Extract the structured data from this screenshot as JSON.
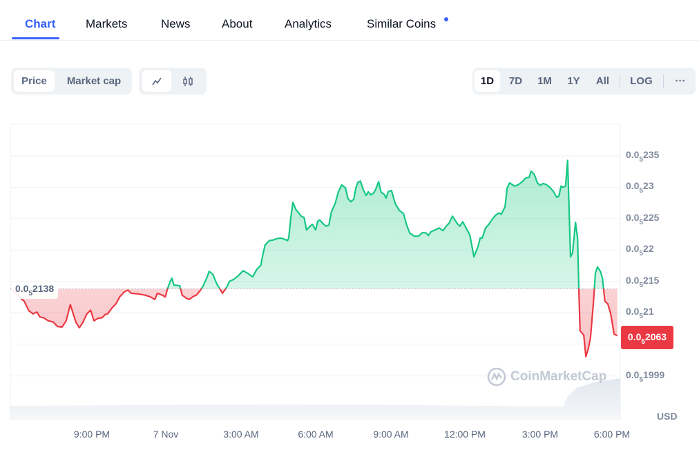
{
  "tabs": [
    {
      "label": "Chart",
      "active": true
    },
    {
      "label": "Markets"
    },
    {
      "label": "News"
    },
    {
      "label": "About"
    },
    {
      "label": "Analytics"
    },
    {
      "label": "Similar Coins",
      "has_dot": true
    }
  ],
  "toolbar": {
    "metric": [
      {
        "label": "Price",
        "active": true
      },
      {
        "label": "Market cap"
      }
    ],
    "chart_style": [
      {
        "icon": "line-chart-icon",
        "active": true
      },
      {
        "icon": "candlestick-icon"
      }
    ],
    "ranges": [
      {
        "label": "1D",
        "active": true
      },
      {
        "label": "7D"
      },
      {
        "label": "1M"
      },
      {
        "label": "1Y"
      },
      {
        "label": "All"
      }
    ],
    "log_label": "LOG",
    "more_label": "···"
  },
  "colors": {
    "accent": "#3861fb",
    "up": "#16c784",
    "down": "#ea3943"
  },
  "watermark": "CoinMarketCap",
  "chart_data": {
    "type": "area",
    "currency_label": "USD",
    "y_tick_labels": [
      {
        "prefix": "0.0",
        "sub": "5",
        "digits": "235",
        "value": 2.35e-06
      },
      {
        "prefix": "0.0",
        "sub": "5",
        "digits": "23",
        "value": 2.3e-06
      },
      {
        "prefix": "0.0",
        "sub": "5",
        "digits": "225",
        "value": 2.25e-06
      },
      {
        "prefix": "0.0",
        "sub": "5",
        "digits": "22",
        "value": 2.2e-06
      },
      {
        "prefix": "0.0",
        "sub": "5",
        "digits": "215",
        "value": 2.15e-06
      },
      {
        "prefix": "0.0",
        "sub": "5",
        "digits": "21",
        "value": 2.1e-06
      },
      {
        "prefix": "0.0",
        "sub": "5",
        "digits": "1999",
        "value": 1.999e-06
      }
    ],
    "x_tick_labels": [
      "9:00 PM",
      "7 Nov",
      "3:00 AM",
      "6:00 AM",
      "9:00 AM",
      "12:00 PM",
      "3:00 PM",
      "6:00 PM"
    ],
    "baseline": {
      "prefix": "0.0",
      "sub": "5",
      "digits": "2138",
      "value": 2.138e-06
    },
    "current": {
      "prefix": "0.0",
      "sub": "5",
      "digits": "2063",
      "value": 2.063e-06
    },
    "grid": true,
    "points": [
      [
        "17:50",
        2.139e-06
      ],
      [
        "18:05",
        2.128e-06
      ],
      [
        "18:22",
        2.118e-06
      ],
      [
        "18:33",
        2.103e-06
      ],
      [
        "18:43",
        2.098e-06
      ],
      [
        "18:52",
        2.101e-06
      ],
      [
        "19:00",
        2.093e-06
      ],
      [
        "19:08",
        2.092e-06
      ],
      [
        "19:20",
        2.087e-06
      ],
      [
        "19:32",
        2.085e-06
      ],
      [
        "19:42",
        2.078e-06
      ],
      [
        "19:53",
        2.077e-06
      ],
      [
        "20:03",
        2.087e-06
      ],
      [
        "20:13",
        2.113e-06
      ],
      [
        "20:20",
        2.098e-06
      ],
      [
        "20:27",
        2.084e-06
      ],
      [
        "20:35",
        2.076e-06
      ],
      [
        "20:43",
        2.084e-06
      ],
      [
        "20:53",
        2.098e-06
      ],
      [
        "21:02",
        2.104e-06
      ],
      [
        "21:10",
        2.087e-06
      ],
      [
        "21:20",
        2.091e-06
      ],
      [
        "21:30",
        2.092e-06
      ],
      [
        "21:37",
        2.097e-06
      ],
      [
        "21:43",
        2.098e-06
      ],
      [
        "21:53",
        2.107e-06
      ],
      [
        "22:03",
        2.114e-06
      ],
      [
        "22:12",
        2.125e-06
      ],
      [
        "22:23",
        2.133e-06
      ],
      [
        "22:32",
        2.136e-06
      ],
      [
        "22:40",
        2.131e-06
      ],
      [
        "22:57",
        2.13e-06
      ],
      [
        "23:13",
        2.128e-06
      ],
      [
        "23:27",
        2.125e-06
      ],
      [
        "23:37",
        2.121e-06
      ],
      [
        "23:43",
        2.131e-06
      ],
      [
        "23:55",
        2.128e-06
      ],
      [
        "00:02",
        2.125e-06
      ],
      [
        "00:08",
        2.139e-06
      ],
      [
        "00:13",
        2.148e-06
      ],
      [
        "00:18",
        2.155e-06
      ],
      [
        "00:23",
        2.144e-06
      ],
      [
        "00:37",
        2.143e-06
      ],
      [
        "00:43",
        2.128e-06
      ],
      [
        "00:53",
        2.123e-06
      ],
      [
        "01:00",
        2.121e-06
      ],
      [
        "01:10",
        2.126e-06
      ],
      [
        "01:17",
        2.128e-06
      ],
      [
        "01:25",
        2.134e-06
      ],
      [
        "01:33",
        2.142e-06
      ],
      [
        "01:42",
        2.155e-06
      ],
      [
        "01:48",
        2.166e-06
      ],
      [
        "01:57",
        2.161e-06
      ],
      [
        "02:07",
        2.145e-06
      ],
      [
        "02:13",
        2.139e-06
      ],
      [
        "02:20",
        2.131e-06
      ],
      [
        "02:30",
        2.14e-06
      ],
      [
        "02:37",
        2.15e-06
      ],
      [
        "02:47",
        2.153e-06
      ],
      [
        "02:57",
        2.158e-06
      ],
      [
        "03:10",
        2.167e-06
      ],
      [
        "03:23",
        2.162e-06
      ],
      [
        "03:33",
        2.157e-06
      ],
      [
        "03:43",
        2.169e-06
      ],
      [
        "03:53",
        2.176e-06
      ],
      [
        "03:57",
        2.191e-06
      ],
      [
        "04:03",
        2.208e-06
      ],
      [
        "04:13",
        2.215e-06
      ],
      [
        "04:23",
        2.216e-06
      ],
      [
        "04:30",
        2.218e-06
      ],
      [
        "04:40",
        2.219e-06
      ],
      [
        "04:47",
        2.218e-06
      ],
      [
        "04:57",
        2.215e-06
      ],
      [
        "05:00",
        2.219e-06
      ],
      [
        "05:05",
        2.251e-06
      ],
      [
        "05:10",
        2.276e-06
      ],
      [
        "05:17",
        2.265e-06
      ],
      [
        "05:23",
        2.26e-06
      ],
      [
        "05:30",
        2.254e-06
      ],
      [
        "05:37",
        2.252e-06
      ],
      [
        "05:43",
        2.232e-06
      ],
      [
        "05:50",
        2.237e-06
      ],
      [
        "05:57",
        2.241e-06
      ],
      [
        "06:05",
        2.232e-06
      ],
      [
        "06:10",
        2.246e-06
      ],
      [
        "06:15",
        2.248e-06
      ],
      [
        "06:23",
        2.242e-06
      ],
      [
        "06:30",
        2.238e-06
      ],
      [
        "06:37",
        2.24e-06
      ],
      [
        "06:43",
        2.261e-06
      ],
      [
        "06:52",
        2.274e-06
      ],
      [
        "07:00",
        2.293e-06
      ],
      [
        "07:08",
        2.304e-06
      ],
      [
        "07:17",
        2.299e-06
      ],
      [
        "07:23",
        2.282e-06
      ],
      [
        "07:30",
        2.277e-06
      ],
      [
        "07:37",
        2.281e-06
      ],
      [
        "07:42",
        2.299e-06
      ],
      [
        "07:47",
        2.308e-06
      ],
      [
        "07:53",
        2.31e-06
      ],
      [
        "08:00",
        2.296e-06
      ],
      [
        "08:07",
        2.287e-06
      ],
      [
        "08:12",
        2.293e-06
      ],
      [
        "08:18",
        2.288e-06
      ],
      [
        "08:25",
        2.291e-06
      ],
      [
        "08:30",
        2.297e-06
      ],
      [
        "08:37",
        2.309e-06
      ],
      [
        "08:43",
        2.292e-06
      ],
      [
        "08:50",
        2.289e-06
      ],
      [
        "08:55",
        2.283e-06
      ],
      [
        "09:00",
        2.293e-06
      ],
      [
        "09:08",
        2.295e-06
      ],
      [
        "09:17",
        2.274e-06
      ],
      [
        "09:27",
        2.263e-06
      ],
      [
        "09:37",
        2.258e-06
      ],
      [
        "09:45",
        2.239e-06
      ],
      [
        "09:52",
        2.227e-06
      ],
      [
        "10:03",
        2.222e-06
      ],
      [
        "10:13",
        2.222e-06
      ],
      [
        "10:23",
        2.228e-06
      ],
      [
        "10:32",
        2.227e-06
      ],
      [
        "10:37",
        2.223e-06
      ],
      [
        "10:43",
        2.229e-06
      ],
      [
        "10:53",
        2.232e-06
      ],
      [
        "11:03",
        2.235e-06
      ],
      [
        "11:12",
        2.231e-06
      ],
      [
        "11:20",
        2.238e-06
      ],
      [
        "11:27",
        2.243e-06
      ],
      [
        "11:35",
        2.254e-06
      ],
      [
        "11:40",
        2.249e-06
      ],
      [
        "11:47",
        2.242e-06
      ],
      [
        "11:53",
        2.238e-06
      ],
      [
        "12:00",
        2.245e-06
      ],
      [
        "12:08",
        2.235e-06
      ],
      [
        "12:17",
        2.224e-06
      ],
      [
        "12:27",
        2.189e-06
      ],
      [
        "12:37",
        2.206e-06
      ],
      [
        "12:42",
        2.219e-06
      ],
      [
        "12:47",
        2.219e-06
      ],
      [
        "12:55",
        2.235e-06
      ],
      [
        "13:03",
        2.241e-06
      ],
      [
        "13:12",
        2.25e-06
      ],
      [
        "13:20",
        2.256e-06
      ],
      [
        "13:27",
        2.259e-06
      ],
      [
        "13:33",
        2.257e-06
      ],
      [
        "13:42",
        2.269e-06
      ],
      [
        "13:47",
        2.299e-06
      ],
      [
        "13:53",
        2.307e-06
      ],
      [
        "14:05",
        2.302e-06
      ],
      [
        "14:13",
        2.304e-06
      ],
      [
        "14:20",
        2.307e-06
      ],
      [
        "14:25",
        2.31e-06
      ],
      [
        "14:32",
        2.315e-06
      ],
      [
        "14:40",
        2.316e-06
      ],
      [
        "14:45",
        2.326e-06
      ],
      [
        "14:53",
        2.32e-06
      ],
      [
        "15:00",
        2.307e-06
      ],
      [
        "15:07",
        2.303e-06
      ],
      [
        "15:13",
        2.306e-06
      ],
      [
        "15:20",
        2.305e-06
      ],
      [
        "15:30",
        2.3e-06
      ],
      [
        "15:38",
        2.294e-06
      ],
      [
        "15:47",
        2.284e-06
      ],
      [
        "15:52",
        2.286e-06
      ],
      [
        "15:57",
        2.302e-06
      ],
      [
        "16:02",
        2.3e-06
      ],
      [
        "16:08",
        2.302e-06
      ],
      [
        "16:13",
        2.343e-06
      ],
      [
        "16:20",
        2.189e-06
      ],
      [
        "16:25",
        2.196e-06
      ],
      [
        "16:32",
        2.244e-06
      ],
      [
        "16:37",
        2.219e-06
      ],
      [
        "16:40",
        2.139e-06
      ],
      [
        "16:43",
        2.071e-06
      ],
      [
        "16:52",
        2.064e-06
      ],
      [
        "16:57",
        2.03e-06
      ],
      [
        "17:03",
        2.043e-06
      ],
      [
        "17:08",
        2.059e-06
      ],
      [
        "17:15",
        2.114e-06
      ],
      [
        "17:20",
        2.163e-06
      ],
      [
        "17:25",
        2.173e-06
      ],
      [
        "17:32",
        2.166e-06
      ],
      [
        "17:37",
        2.155e-06
      ],
      [
        "17:43",
        2.118e-06
      ],
      [
        "17:50",
        2.114e-06
      ],
      [
        "17:57",
        2.098e-06
      ],
      [
        "18:05",
        2.066e-06
      ],
      [
        "18:13",
        2.063e-06
      ]
    ]
  }
}
